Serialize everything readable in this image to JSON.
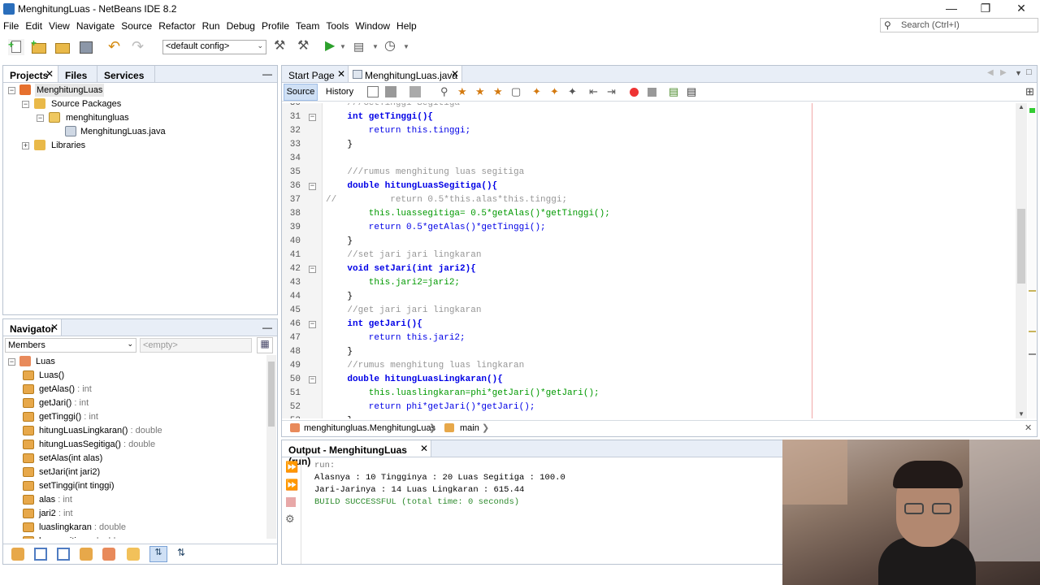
{
  "window": {
    "title": "MenghitungLuas - NetBeans IDE 8.2"
  },
  "menu": [
    "File",
    "Edit",
    "View",
    "Navigate",
    "Source",
    "Refactor",
    "Run",
    "Debug",
    "Profile",
    "Team",
    "Tools",
    "Window",
    "Help"
  ],
  "search": {
    "placeholder": "Search (Ctrl+I)"
  },
  "toolbar": {
    "config": "<default config>"
  },
  "projects": {
    "tabs": [
      "Projects",
      "Files",
      "Services"
    ],
    "tree": {
      "project": "MenghitungLuas",
      "source_packages": "Source Packages",
      "package": "menghitungluas",
      "file": "MenghitungLuas.java",
      "libraries": "Libraries"
    }
  },
  "navigator": {
    "title": "Navigator",
    "members_label": "Members",
    "filter_placeholder": "<empty>",
    "root": "Luas",
    "members": [
      {
        "name": "Luas()",
        "type": ""
      },
      {
        "name": "getAlas()",
        "type": " : int"
      },
      {
        "name": "getJari()",
        "type": " : int"
      },
      {
        "name": "getTinggi()",
        "type": " : int"
      },
      {
        "name": "hitungLuasLingkaran()",
        "type": " : double"
      },
      {
        "name": "hitungLuasSegitiga()",
        "type": " : double"
      },
      {
        "name": "setAlas(int alas)",
        "type": ""
      },
      {
        "name": "setJari(int jari2)",
        "type": ""
      },
      {
        "name": "setTinggi(int tinggi)",
        "type": ""
      },
      {
        "name": "alas",
        "type": " : int"
      },
      {
        "name": "jari2",
        "type": " : int"
      },
      {
        "name": "luaslingkaran",
        "type": " : double"
      },
      {
        "name": "luassegitiga",
        "type": " : double"
      }
    ]
  },
  "editor": {
    "tabs": [
      "Start Page",
      "MenghitungLuas.java"
    ],
    "modes": [
      "Source",
      "History"
    ],
    "lines": [
      {
        "n": "30",
        "text": "    ///GetTinggi Segitiga"
      },
      {
        "n": "31",
        "text": "    int getTinggi(){"
      },
      {
        "n": "32",
        "text": "        return this.tinggi;"
      },
      {
        "n": "33",
        "text": "    }"
      },
      {
        "n": "34",
        "text": ""
      },
      {
        "n": "35",
        "text": "    ///rumus menghitung luas segitiga"
      },
      {
        "n": "36",
        "text": "    double hitungLuasSegitiga(){"
      },
      {
        "n": "37",
        "text": "//          return 0.5*this.alas*this.tinggi;"
      },
      {
        "n": "38",
        "text": "        this.luassegitiga= 0.5*getAlas()*getTinggi();"
      },
      {
        "n": "39",
        "text": "        return 0.5*getAlas()*getTinggi();"
      },
      {
        "n": "40",
        "text": "    }"
      },
      {
        "n": "41",
        "text": "    //set jari jari lingkaran"
      },
      {
        "n": "42",
        "text": "    void setJari(int jari2){"
      },
      {
        "n": "43",
        "text": "        this.jari2=jari2;"
      },
      {
        "n": "44",
        "text": "    }"
      },
      {
        "n": "45",
        "text": "    //get jari jari lingkaran"
      },
      {
        "n": "46",
        "text": "    int getJari(){"
      },
      {
        "n": "47",
        "text": "        return this.jari2;"
      },
      {
        "n": "48",
        "text": "    }"
      },
      {
        "n": "49",
        "text": "    //rumus menghitung luas lingkaran"
      },
      {
        "n": "50",
        "text": "    double hitungLuasLingkaran(){"
      },
      {
        "n": "51",
        "text": "        this.luaslingkaran=phi*getJari()*getJari();"
      },
      {
        "n": "52",
        "text": "        return phi*getJari()*getJari();"
      },
      {
        "n": "53",
        "text": "    }"
      }
    ],
    "breadcrumb": [
      "menghitungluas.MenghitungLuas",
      "main"
    ]
  },
  "output": {
    "title": "Output - MenghitungLuas (run)",
    "lines": [
      "run:",
      "Alasnya : 10 Tingginya : 20 Luas Segitiga : 100.0",
      "Jari-Jarinya : 14 Luas Lingkaran : 615.44",
      "BUILD SUCCESSFUL (total time: 0 seconds)"
    ]
  }
}
